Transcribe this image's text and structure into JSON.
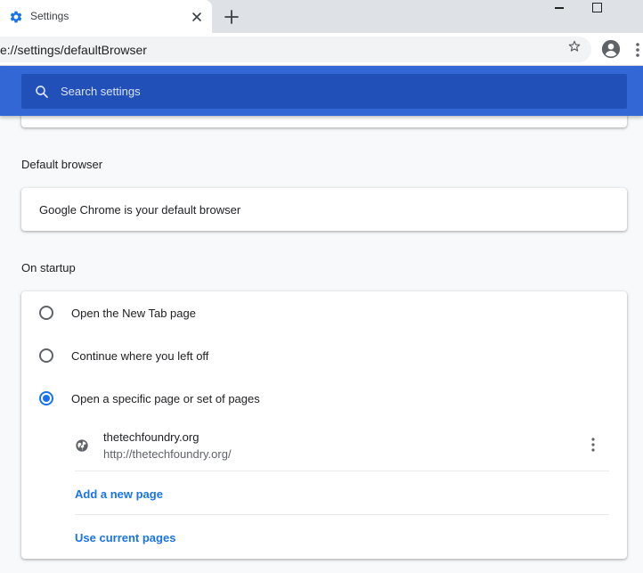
{
  "tab": {
    "title": "Settings",
    "favicon": "gear-icon"
  },
  "toolbar": {
    "url": "e://settings/defaultBrowser"
  },
  "search": {
    "placeholder": "Search settings"
  },
  "default_browser": {
    "title": "Default browser",
    "status": "Google Chrome is your default browser"
  },
  "on_startup": {
    "title": "On startup",
    "options": [
      {
        "label": "Open the New Tab page",
        "checked": false
      },
      {
        "label": "Continue where you left off",
        "checked": false
      },
      {
        "label": "Open a specific page or set of pages",
        "checked": true
      }
    ],
    "pages": [
      {
        "name": "thetechfoundry.org",
        "url": "http://thetechfoundry.org/"
      }
    ],
    "add_page_label": "Add a new page",
    "use_current_label": "Use current pages"
  },
  "colors": {
    "accent": "#1a73e8",
    "banner": "#3367d6",
    "searchbox": "#2150b8"
  }
}
